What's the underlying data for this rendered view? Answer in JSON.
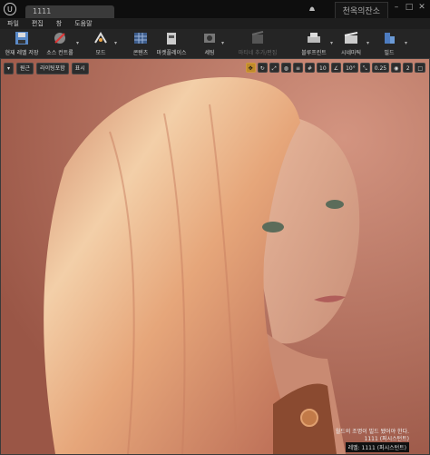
{
  "document_tab": "1111",
  "project_name": "천옥의잔소",
  "menu": [
    "파일",
    "편집",
    "창",
    "도움말"
  ],
  "toolbar": [
    {
      "label": "현재 레벨 저장"
    },
    {
      "label": "소스 컨트롤",
      "dropdown": true
    },
    {
      "label": "모드",
      "dropdown": true
    },
    {
      "label": "콘텐츠"
    },
    {
      "label": "마켓플레이스"
    },
    {
      "label": "세팅",
      "dropdown": true
    },
    {
      "label": "마티네 추가/편집",
      "disabled": true
    },
    {
      "label": "블루프린트",
      "dropdown": true
    },
    {
      "label": "시네마틱",
      "dropdown": true
    },
    {
      "label": "빌드",
      "dropdown": true
    }
  ],
  "viewport": {
    "perspective_label": "원근",
    "lighting_label": "라이팅포함",
    "show_label": "표시",
    "grid_snap_value": "10",
    "rotation_snap_value": "10°",
    "scale_snap_value": "0.25",
    "camera_speed_value": "2",
    "overlay_line1": "월드의 조명이 빌드 됐어야 한다.",
    "overlay_line2": "1111 (퍼시스턴트)",
    "level_label": "레벨: 1111 (퍼시스턴트)"
  },
  "colors": {
    "accent": "#c08a2a",
    "toolbar_bg": "#252525",
    "titlebar_bg": "#0e0e0e"
  }
}
